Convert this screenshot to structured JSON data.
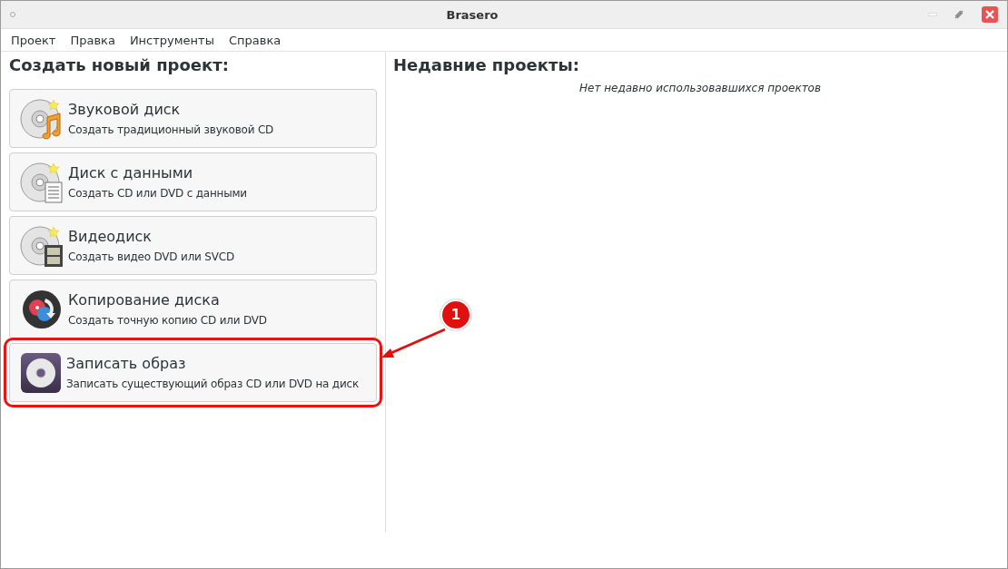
{
  "window": {
    "title": "Brasero"
  },
  "menu": [
    "Проект",
    "Правка",
    "Инструменты",
    "Справка"
  ],
  "new_project": {
    "heading": "Создать новый проект:",
    "items": [
      {
        "kind": "audio",
        "title": "Звуковой диск",
        "subtitle": "Создать традиционный звуковой CD",
        "highlighted": false
      },
      {
        "kind": "data",
        "title": "Диск с данными",
        "subtitle": "Создать CD или DVD с данными",
        "highlighted": false
      },
      {
        "kind": "video",
        "title": "Видеодиск",
        "subtitle": "Создать видео DVD или SVCD",
        "highlighted": false
      },
      {
        "kind": "copy",
        "title": "Копирование диска",
        "subtitle": "Создать точную копию CD или DVD",
        "highlighted": false
      },
      {
        "kind": "image",
        "title": "Записать образ",
        "subtitle": "Записать существующий образ CD или DVD на диск",
        "highlighted": true
      }
    ]
  },
  "recent_projects": {
    "heading": "Недавние проекты:",
    "empty_message": "Нет недавно использовавшихся проектов"
  },
  "annotation": {
    "number": "1"
  }
}
